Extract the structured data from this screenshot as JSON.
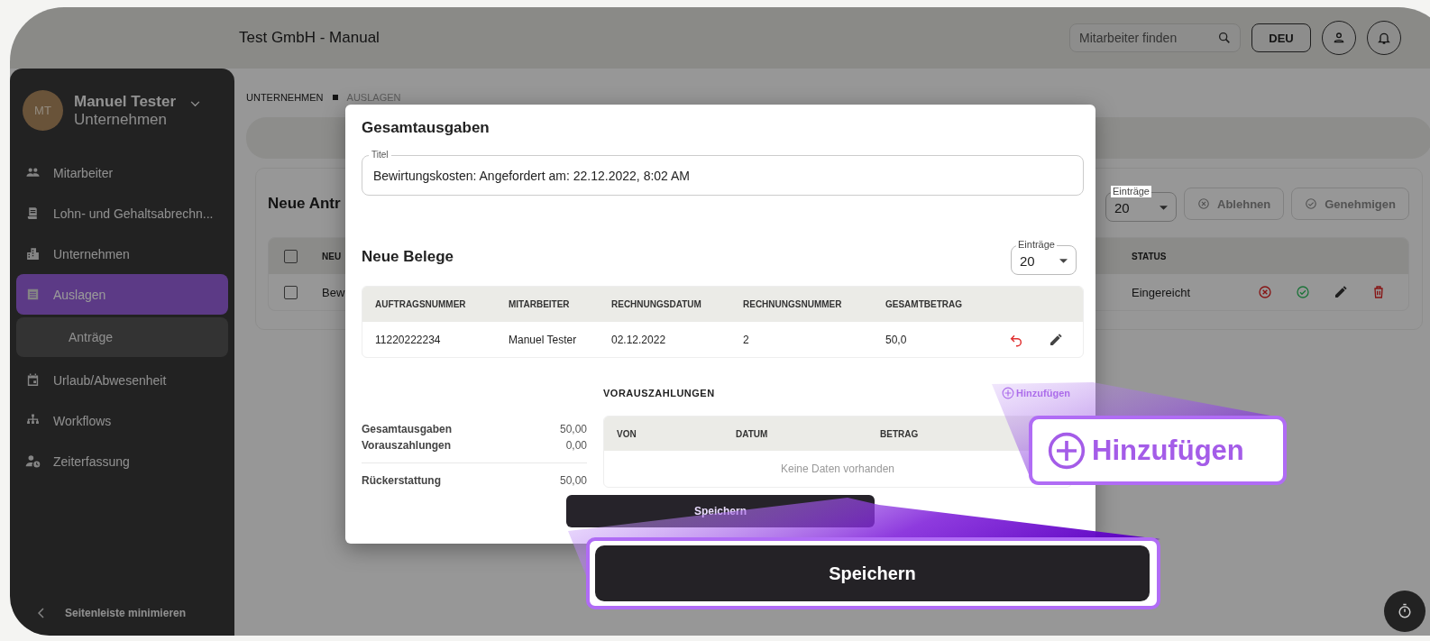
{
  "header": {
    "title": "Test GmbH - Manual",
    "search": {
      "placeholder": "Mitarbeiter finden"
    },
    "language": "DEU"
  },
  "sidebar": {
    "user": {
      "initials": "MT",
      "name": "Manuel Tester",
      "subtitle": "Unternehmen"
    },
    "items": [
      {
        "label": "Mitarbeiter",
        "selected": false
      },
      {
        "label": "Lohn- und Gehaltsabrechn...",
        "selected": false
      },
      {
        "label": "Unternehmen",
        "selected": false
      },
      {
        "label": "Auslagen",
        "selected": true,
        "children": [
          {
            "label": "Anträge",
            "selected": true
          }
        ]
      },
      {
        "label": "Urlaub/Abwesenheit",
        "selected": false
      },
      {
        "label": "Workflows",
        "selected": false
      },
      {
        "label": "Zeiterfassung",
        "selected": false
      }
    ],
    "collapse": "Seitenleiste minimieren"
  },
  "breadcrumb": [
    {
      "label": "UNTERNEHMEN",
      "selected": false
    },
    {
      "label": "AUSLAGEN",
      "selected": true
    }
  ],
  "requests_card": {
    "title": "Neue Antr",
    "page_size": {
      "label": "Einträge",
      "value": "20"
    },
    "actions": [
      {
        "label": "Ablehnen",
        "kind": "reject",
        "disabled": true
      },
      {
        "label": "Genehmigen",
        "kind": "approve",
        "disabled": true
      }
    ],
    "all_checked": false,
    "columns": [
      "NEU",
      "STATUS"
    ],
    "rows": [
      {
        "checked": false,
        "column_1": "Bew",
        "status": "Eingereicht"
      }
    ]
  },
  "dialog": {
    "title": "Gesamtausgaben",
    "title_field": {
      "label": "Titel",
      "value": "Bewirtungskosten: Angefordert am: 22.12.2022, 8:02 AM"
    },
    "receipts": {
      "title": "Neue Belege",
      "page_size": {
        "label": "Einträge",
        "value": "20"
      },
      "columns": [
        "AUFTRAGSNUMMER",
        "MITARBEITER",
        "RECHNUNGSDATUM",
        "RECHNUNGSNUMMER",
        "GESAMTBETRAG"
      ],
      "rows": [
        {
          "cells": [
            "11220222234",
            "Manuel Tester",
            "02.12.2022",
            "2",
            "50,0"
          ]
        }
      ]
    },
    "summary": [
      {
        "label": "Gesamtausgaben",
        "value": "50,00",
        "total": false
      },
      {
        "label": "Vorauszahlungen",
        "value": "0,00",
        "total": false
      },
      {
        "label": "Rückerstattung",
        "value": "50,00",
        "total": true
      }
    ],
    "advance_payments": {
      "title": "VORAUSZAHLUNGEN",
      "add": "Hinzufügen",
      "columns": [
        "VON",
        "DATUM",
        "BETRAG"
      ],
      "empty": "Keine Daten vorhanden"
    },
    "save": "Speichern"
  },
  "callouts": [
    {
      "kind": "add",
      "label": "Hinzufügen"
    },
    {
      "kind": "button",
      "label": "Speichern"
    }
  ]
}
